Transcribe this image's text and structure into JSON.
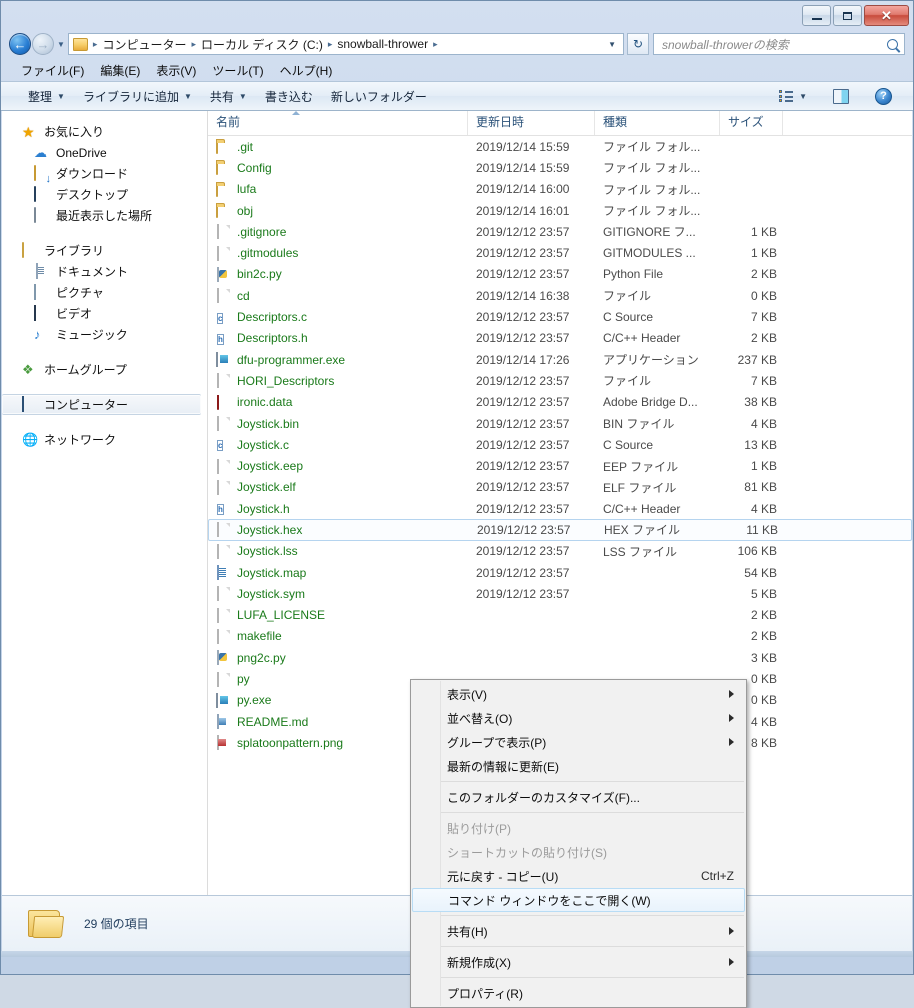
{
  "window": {
    "minimize_label": "–",
    "maximize_label": "□",
    "close_label": "✕"
  },
  "address": {
    "back_label": "←",
    "forward_label": "→",
    "history_caret": "▼",
    "crumbs": [
      "コンピューター",
      "ローカル ディスク (C:)",
      "snowball-thrower"
    ],
    "separator": "▸",
    "dropdown_caret": "▼",
    "refresh_label": "↻"
  },
  "search": {
    "placeholder": "snowball-throwerの検索"
  },
  "menubar": {
    "items": [
      "ファイル(F)",
      "編集(E)",
      "表示(V)",
      "ツール(T)",
      "ヘルプ(H)"
    ]
  },
  "toolbar": {
    "items": [
      {
        "label": "整理",
        "caret": true
      },
      {
        "label": "ライブラリに追加",
        "caret": true
      },
      {
        "label": "共有",
        "caret": true
      },
      {
        "label": "書き込む",
        "caret": false
      },
      {
        "label": "新しいフォルダー",
        "caret": false
      }
    ],
    "views_caret": "▼",
    "help_label": "?"
  },
  "sidebar": {
    "groups": [
      {
        "header": {
          "label": "お気に入り",
          "icon": "star-icon"
        },
        "items": [
          {
            "label": "OneDrive",
            "icon": "cloud-icon"
          },
          {
            "label": "ダウンロード",
            "icon": "download-folder-icon"
          },
          {
            "label": "デスクトップ",
            "icon": "desktop-icon"
          },
          {
            "label": "最近表示した場所",
            "icon": "recent-places-icon"
          }
        ]
      },
      {
        "header": {
          "label": "ライブラリ",
          "icon": "library-icon"
        },
        "items": [
          {
            "label": "ドキュメント",
            "icon": "documents-icon"
          },
          {
            "label": "ピクチャ",
            "icon": "pictures-icon"
          },
          {
            "label": "ビデオ",
            "icon": "videos-icon"
          },
          {
            "label": "ミュージック",
            "icon": "music-icon"
          }
        ]
      },
      {
        "header": {
          "label": "ホームグループ",
          "icon": "homegroup-icon"
        },
        "items": []
      },
      {
        "header": {
          "label": "コンピューター",
          "icon": "computer-icon",
          "selected": true
        },
        "items": []
      },
      {
        "header": {
          "label": "ネットワーク",
          "icon": "network-icon"
        },
        "items": []
      }
    ]
  },
  "columns": {
    "name": "名前",
    "date": "更新日時",
    "type": "種類",
    "size": "サイズ"
  },
  "files": [
    {
      "name": ".git",
      "date": "2019/12/14 15:59",
      "type": "ファイル フォル...",
      "size": "",
      "icon": "folder-icon"
    },
    {
      "name": "Config",
      "date": "2019/12/14 15:59",
      "type": "ファイル フォル...",
      "size": "",
      "icon": "folder-icon"
    },
    {
      "name": "lufa",
      "date": "2019/12/14 16:00",
      "type": "ファイル フォル...",
      "size": "",
      "icon": "folder-icon"
    },
    {
      "name": "obj",
      "date": "2019/12/14 16:01",
      "type": "ファイル フォル...",
      "size": "",
      "icon": "folder-icon"
    },
    {
      "name": ".gitignore",
      "date": "2019/12/12 23:57",
      "type": "GITIGNORE フ...",
      "size": "1 KB",
      "icon": "blank-file-icon"
    },
    {
      "name": ".gitmodules",
      "date": "2019/12/12 23:57",
      "type": "GITMODULES ...",
      "size": "1 KB",
      "icon": "blank-file-icon"
    },
    {
      "name": "bin2c.py",
      "date": "2019/12/12 23:57",
      "type": "Python File",
      "size": "2 KB",
      "icon": "python-file-icon"
    },
    {
      "name": "cd",
      "date": "2019/12/14 16:38",
      "type": "ファイル",
      "size": "0 KB",
      "icon": "blank-file-icon"
    },
    {
      "name": "Descriptors.c",
      "date": "2019/12/12 23:57",
      "type": "C Source",
      "size": "7 KB",
      "icon": "c-source-icon",
      "glyph": "c"
    },
    {
      "name": "Descriptors.h",
      "date": "2019/12/12 23:57",
      "type": "C/C++ Header",
      "size": "2 KB",
      "icon": "c-header-icon",
      "glyph": "h"
    },
    {
      "name": "dfu-programmer.exe",
      "date": "2019/12/14 17:26",
      "type": "アプリケーション",
      "size": "237 KB",
      "icon": "executable-icon"
    },
    {
      "name": "HORI_Descriptors",
      "date": "2019/12/12 23:57",
      "type": "ファイル",
      "size": "7 KB",
      "icon": "blank-file-icon"
    },
    {
      "name": "ironic.data",
      "date": "2019/12/12 23:57",
      "type": "Adobe Bridge D...",
      "size": "38 KB",
      "icon": "adobe-bridge-icon"
    },
    {
      "name": "Joystick.bin",
      "date": "2019/12/12 23:57",
      "type": "BIN ファイル",
      "size": "4 KB",
      "icon": "blank-file-icon"
    },
    {
      "name": "Joystick.c",
      "date": "2019/12/12 23:57",
      "type": "C Source",
      "size": "13 KB",
      "icon": "c-source-icon",
      "glyph": "c"
    },
    {
      "name": "Joystick.eep",
      "date": "2019/12/12 23:57",
      "type": "EEP ファイル",
      "size": "1 KB",
      "icon": "blank-file-icon"
    },
    {
      "name": "Joystick.elf",
      "date": "2019/12/12 23:57",
      "type": "ELF ファイル",
      "size": "81 KB",
      "icon": "blank-file-icon"
    },
    {
      "name": "Joystick.h",
      "date": "2019/12/12 23:57",
      "type": "C/C++ Header",
      "size": "4 KB",
      "icon": "c-header-icon",
      "glyph": "h"
    },
    {
      "name": "Joystick.hex",
      "date": "2019/12/12 23:57",
      "type": "HEX ファイル",
      "size": "11 KB",
      "icon": "blank-file-icon",
      "selected": true
    },
    {
      "name": "Joystick.lss",
      "date": "2019/12/12 23:57",
      "type": "LSS ファイル",
      "size": "106 KB",
      "icon": "blank-file-icon"
    },
    {
      "name": "Joystick.map",
      "date": "2019/12/12 23:57",
      "type": "",
      "size": "54 KB",
      "icon": "map-file-icon"
    },
    {
      "name": "Joystick.sym",
      "date": "2019/12/12 23:57",
      "type": "",
      "size": "5 KB",
      "icon": "blank-file-icon"
    },
    {
      "name": "LUFA_LICENSE",
      "date": "",
      "type": "",
      "size": "2 KB",
      "icon": "blank-file-icon"
    },
    {
      "name": "makefile",
      "date": "",
      "type": "",
      "size": "2 KB",
      "icon": "blank-file-icon"
    },
    {
      "name": "png2c.py",
      "date": "",
      "type": "",
      "size": "3 KB",
      "icon": "python-file-icon"
    },
    {
      "name": "py",
      "date": "",
      "type": "",
      "size": "0 KB",
      "icon": "blank-file-icon"
    },
    {
      "name": "py.exe",
      "date": "",
      "type": "",
      "size": "0 KB",
      "icon": "executable-icon"
    },
    {
      "name": "README.md",
      "date": "",
      "type": "",
      "size": "4 KB",
      "icon": "markdown-file-icon"
    },
    {
      "name": "splatoonpattern.png",
      "date": "",
      "type": "",
      "size": "8 KB",
      "icon": "image-file-icon"
    }
  ],
  "context_menu": {
    "items": [
      {
        "label": "表示(V)",
        "submenu": true
      },
      {
        "label": "並べ替え(O)",
        "submenu": true
      },
      {
        "label": "グループで表示(P)",
        "submenu": true
      },
      {
        "label": "最新の情報に更新(E)"
      },
      {
        "separator": true
      },
      {
        "label": "このフォルダーのカスタマイズ(F)..."
      },
      {
        "separator": true
      },
      {
        "label": "貼り付け(P)",
        "disabled": true
      },
      {
        "label": "ショートカットの貼り付け(S)",
        "disabled": true
      },
      {
        "label": "元に戻す - コピー(U)",
        "accel": "Ctrl+Z"
      },
      {
        "label": "コマンド ウィンドウをここで開く(W)",
        "highlight": true
      },
      {
        "separator": true
      },
      {
        "label": "共有(H)",
        "submenu": true
      },
      {
        "separator": true
      },
      {
        "label": "新規作成(X)",
        "submenu": true
      },
      {
        "separator": true
      },
      {
        "label": "プロパティ(R)"
      }
    ]
  },
  "status": {
    "item_count": "29 個の項目"
  },
  "colors": {
    "file_name_green": "#1a7a1a",
    "selection_border": "#b5d4ef",
    "chrome_blue": "#c7d6ea"
  }
}
